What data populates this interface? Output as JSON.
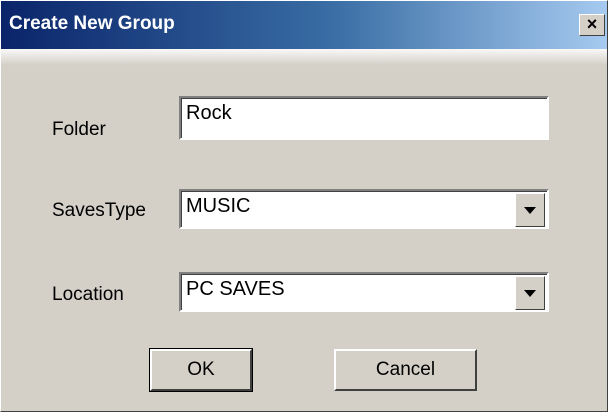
{
  "window": {
    "title": "Create New Group",
    "close_label": "×"
  },
  "form": {
    "folder": {
      "label": "Folder",
      "value": "Rock"
    },
    "saves_type": {
      "label": "SavesType",
      "value": "MUSIC"
    },
    "location": {
      "label": "Location",
      "value": "PC SAVES"
    }
  },
  "buttons": {
    "ok": "OK",
    "cancel": "Cancel"
  }
}
